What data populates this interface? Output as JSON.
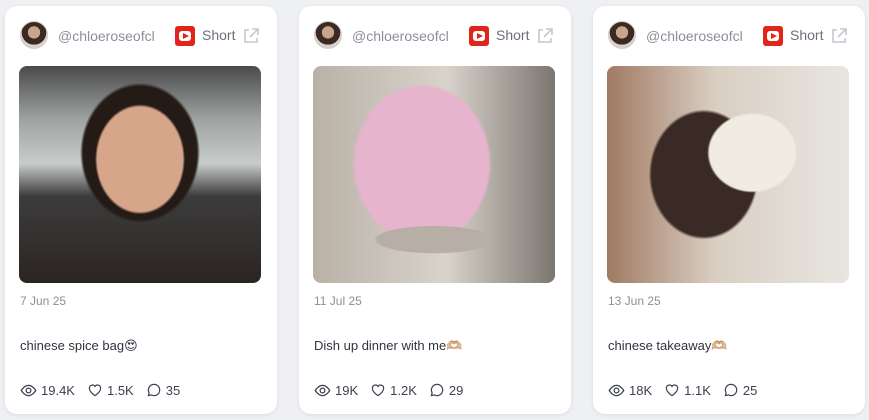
{
  "cards": [
    {
      "handle": "@chloeroseofcl",
      "type_label": "Short",
      "date": "7 Jun 25",
      "caption": "chinese spice bag😍",
      "views": "19.4K",
      "likes": "1.5K",
      "comments": "35"
    },
    {
      "handle": "@chloeroseofcl",
      "type_label": "Short",
      "date": "11 Jul 25",
      "caption": "Dish up dinner with me🫶🏼",
      "views": "19K",
      "likes": "1.2K",
      "comments": "29"
    },
    {
      "handle": "@chloeroseofcl",
      "type_label": "Short",
      "date": "13 Jun 25",
      "caption": "chinese takeaway🫶🏼",
      "views": "18K",
      "likes": "1.1K",
      "comments": "25"
    }
  ],
  "icons": {
    "platform": "youtube-icon",
    "external": "external-link-icon",
    "views": "eye-icon",
    "likes": "heart-icon",
    "comments": "comment-icon"
  },
  "colors": {
    "youtube_red": "#e1251b",
    "muted_text": "#8a8f98"
  }
}
